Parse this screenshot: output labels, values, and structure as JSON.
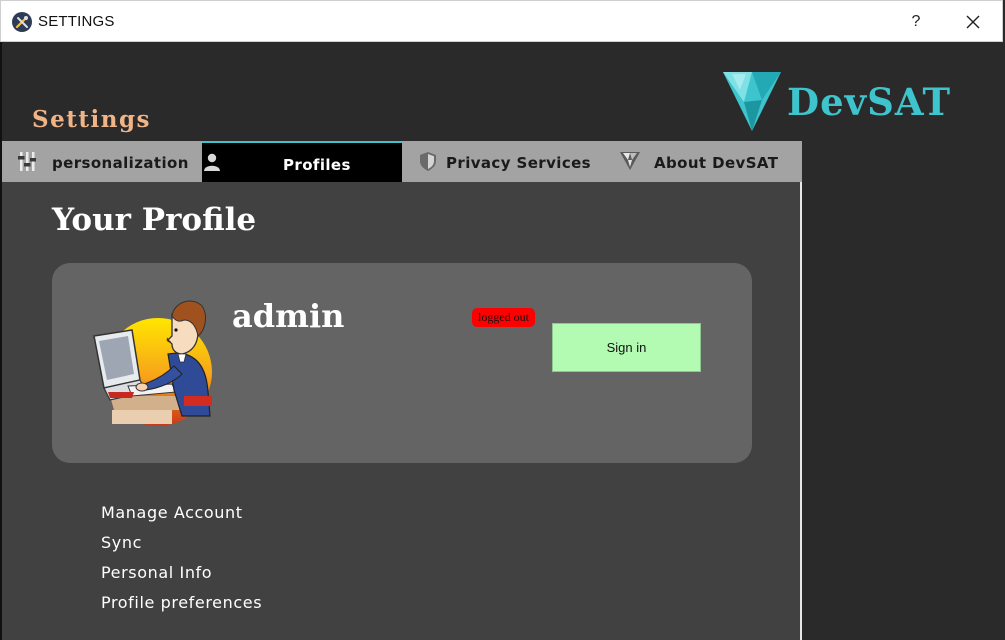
{
  "window": {
    "title": "SETTINGS",
    "help_label": "?"
  },
  "brand": {
    "name": "DevSAT",
    "color": "#3ec4cc"
  },
  "settings_heading": "Settings",
  "tabs": [
    {
      "label": "personalization",
      "icon": "sliders-icon",
      "active": false
    },
    {
      "label": "Profiles",
      "icon": "user-icon",
      "active": true
    },
    {
      "label": "Privacy Services",
      "icon": "shield-icon",
      "active": false
    },
    {
      "label": "About DevSAT",
      "icon": "devsat-logo-icon",
      "active": false
    }
  ],
  "profile": {
    "heading": "Your Profile",
    "username": "admin",
    "status": "logged out",
    "sign_in_label": "Sign in"
  },
  "links": [
    "Manage Account",
    "Sync",
    "Personal Info",
    "Profile preferences"
  ],
  "colors": {
    "accent": "#3ec4cc",
    "settings_heading": "#f0b487",
    "status_badge": "#ff0000",
    "sign_in_bg": "#b3fbb3"
  }
}
